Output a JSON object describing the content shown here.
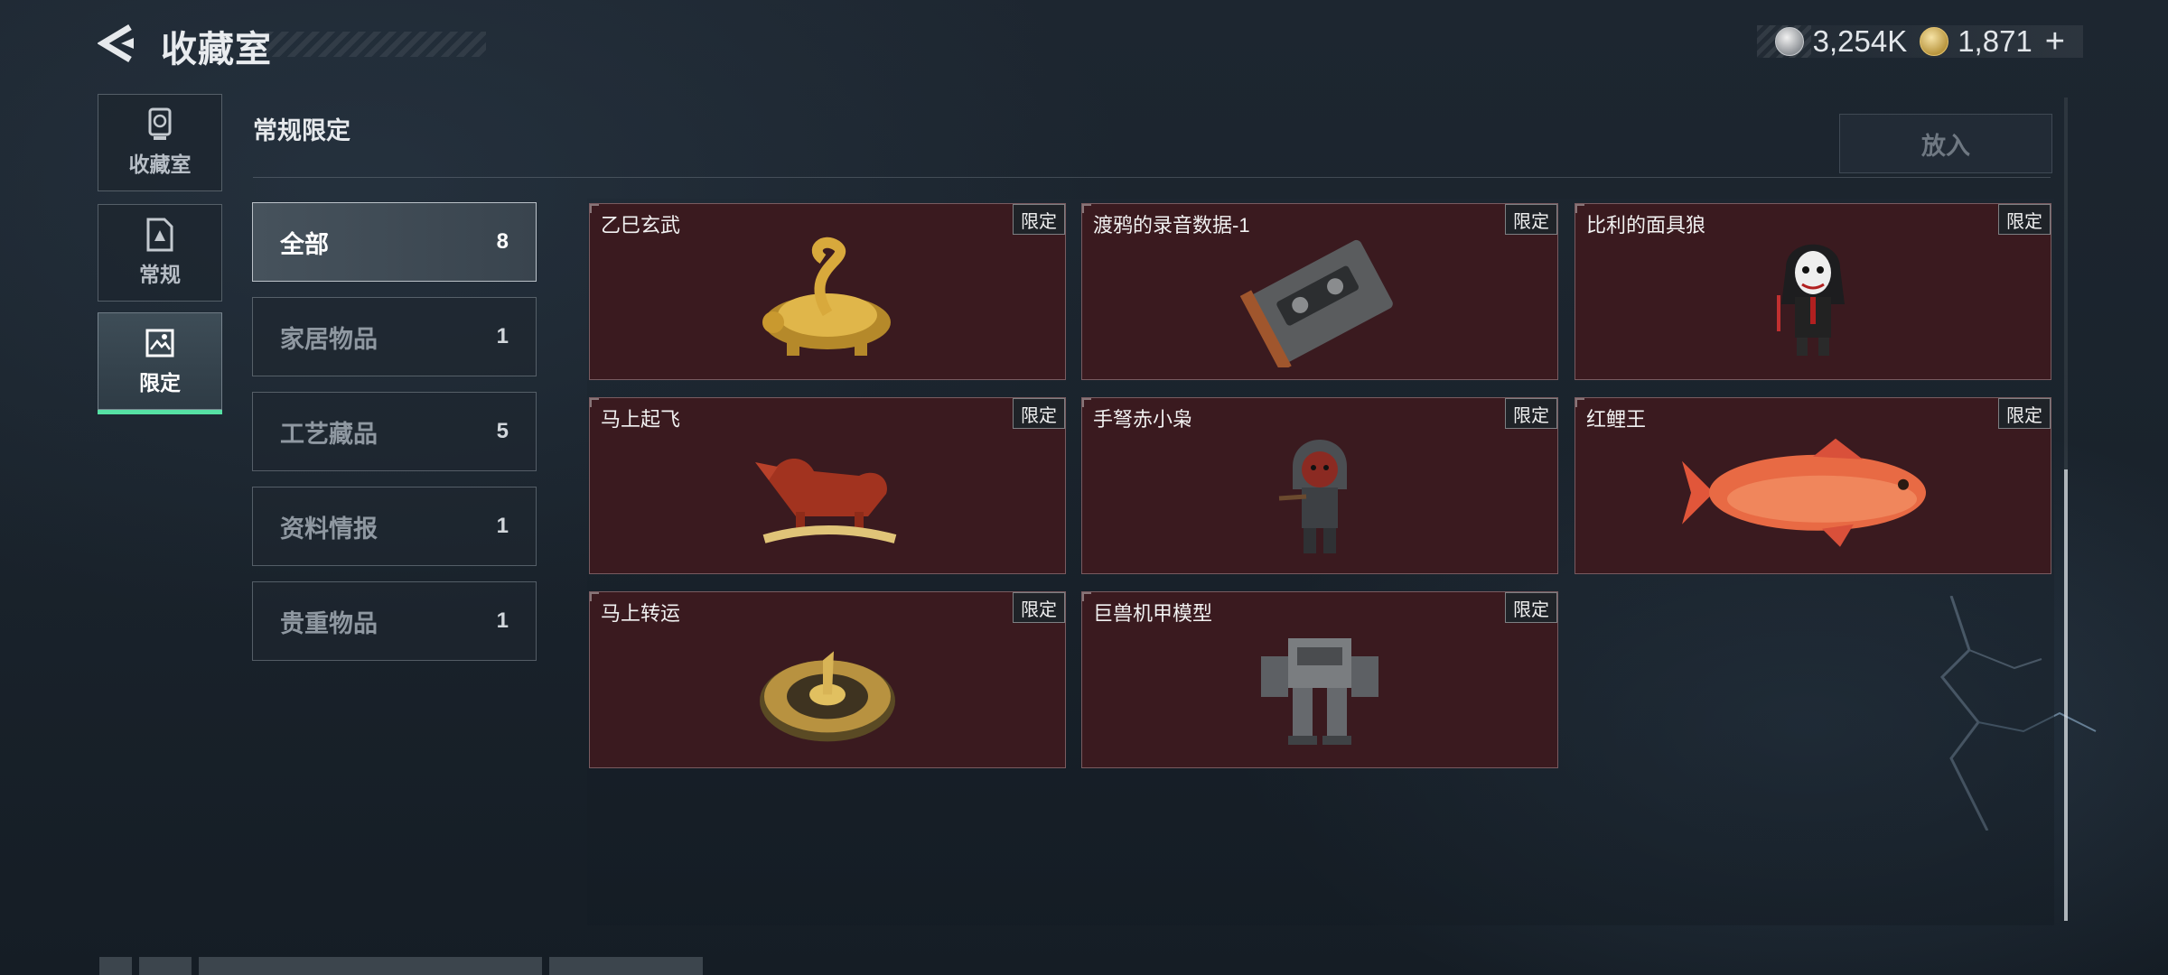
{
  "header": {
    "title": "收藏室",
    "currencies": [
      {
        "icon": "silver-coin-icon",
        "value": "3,254K"
      },
      {
        "icon": "gold-coin-icon",
        "value": "1,871"
      }
    ],
    "plus_label": "+"
  },
  "rail": [
    {
      "label": "收藏室",
      "icon": "trophy-icon"
    },
    {
      "label": "常规",
      "icon": "document-icon"
    },
    {
      "label": "限定",
      "icon": "picture-icon",
      "active": true
    }
  ],
  "section": {
    "title": "常规限定",
    "place_button": "放入"
  },
  "categories": [
    {
      "name": "全部",
      "count": "8",
      "active": true
    },
    {
      "name": "家居物品",
      "count": "1"
    },
    {
      "name": "工艺藏品",
      "count": "5"
    },
    {
      "name": "资料情报",
      "count": "1"
    },
    {
      "name": "贵重物品",
      "count": "1"
    }
  ],
  "items": [
    {
      "name": "乙巳玄武",
      "tag": "限定",
      "icon": "golden-tortoise-snake-icon"
    },
    {
      "name": "渡鸦的录音数据-1",
      "tag": "限定",
      "icon": "cassette-tape-icon"
    },
    {
      "name": "比利的面具狼",
      "tag": "限定",
      "icon": "puppet-figure-icon"
    },
    {
      "name": "马上起飞",
      "tag": "限定",
      "icon": "horse-statue-icon"
    },
    {
      "name": "手弩赤小枭",
      "tag": "限定",
      "icon": "hooded-figure-icon"
    },
    {
      "name": "红鲤王",
      "tag": "限定",
      "icon": "red-carp-icon"
    },
    {
      "name": "马上转运",
      "tag": "限定",
      "icon": "golden-wheel-icon"
    },
    {
      "name": "巨兽机甲模型",
      "tag": "限定",
      "icon": "mech-model-icon"
    }
  ],
  "colors": {
    "accent": "#56e1a4",
    "card_bg": "#3a1a1f",
    "background": "#1a232c"
  }
}
